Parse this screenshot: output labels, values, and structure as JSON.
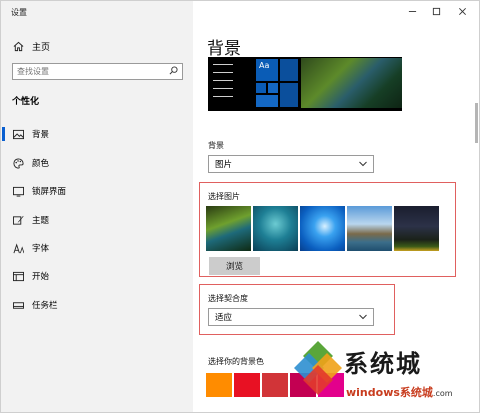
{
  "window": {
    "title": "设置",
    "controls": [
      "minimize-icon",
      "maximize-icon",
      "close-icon"
    ]
  },
  "sidebar": {
    "home_label": "主页",
    "search_placeholder": "查找设置",
    "section_title": "个性化",
    "items": [
      {
        "label": "背景",
        "icon": "picture-icon",
        "selected": true
      },
      {
        "label": "颜色",
        "icon": "palette-icon",
        "selected": false
      },
      {
        "label": "锁屏界面",
        "icon": "lock-screen-icon",
        "selected": false
      },
      {
        "label": "主题",
        "icon": "theme-brush-icon",
        "selected": false
      },
      {
        "label": "字体",
        "icon": "font-icon",
        "selected": false
      },
      {
        "label": "开始",
        "icon": "start-menu-icon",
        "selected": false
      },
      {
        "label": "任务栏",
        "icon": "taskbar-icon",
        "selected": false
      }
    ]
  },
  "main": {
    "heading": "背景",
    "preview_tile_text": "Aa",
    "background": {
      "label": "背景",
      "value": "图片"
    },
    "choose_picture": {
      "label": "选择图片",
      "browse_label": "浏览"
    },
    "fit": {
      "label": "选择契合度",
      "value": "适应"
    },
    "bg_color_label": "选择你的背景色",
    "accent_colors": [
      "#ff8c00",
      "#e81123",
      "#d13438",
      "#c30052",
      "#e3008c"
    ]
  },
  "watermark": {
    "text": "系统城",
    "url": "windows系统城",
    "url_suffix": ".com"
  },
  "colors": {
    "accent": "#0a5fd0",
    "highlight_box": "#e0605f",
    "sidebar_bg": "#f2f2f2"
  }
}
